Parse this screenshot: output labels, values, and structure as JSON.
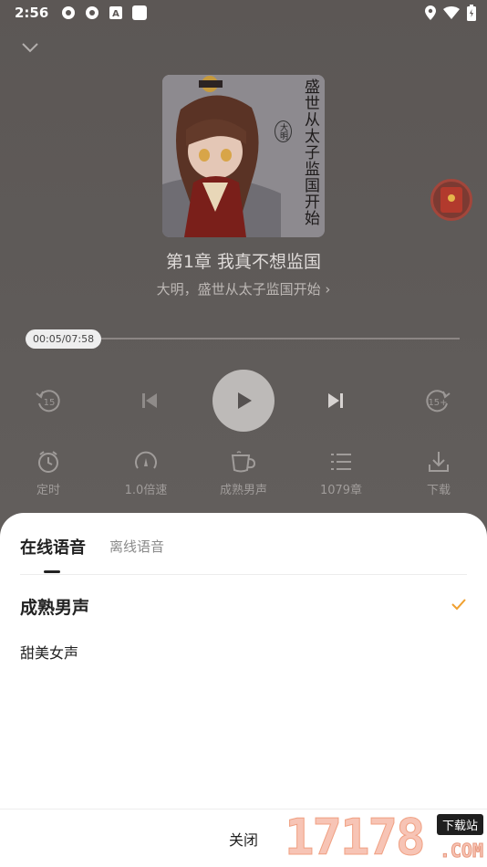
{
  "status_bar": {
    "time": "2:56"
  },
  "player": {
    "cover": {
      "title": "盛世从太子监国开始",
      "badge": "大明"
    },
    "chapter_title": "第1章 我真不想监国",
    "book_link": "大明，盛世从太子监国开始 ›",
    "progress": {
      "time_label": "00:05/07:58",
      "fraction": 0.0105
    },
    "controls": {
      "rewind_label": "15",
      "forward_label": "15+"
    },
    "tools": [
      {
        "label": "定时",
        "icon": "timer-icon"
      },
      {
        "label": "1.0倍速",
        "icon": "speed-icon"
      },
      {
        "label": "成熟男声",
        "icon": "voice-icon"
      },
      {
        "label": "1079章",
        "icon": "chapters-icon"
      },
      {
        "label": "下载",
        "icon": "download-icon"
      }
    ]
  },
  "sheet": {
    "tabs": {
      "online": "在线语音",
      "offline": "离线语音"
    },
    "voices": [
      {
        "label": "成熟男声",
        "selected": true
      },
      {
        "label": "甜美女声",
        "selected": false
      }
    ],
    "close_label": "关闭",
    "accent_color": "#f0a030"
  },
  "watermark": {
    "number": "17178",
    "tag": "下载站",
    "suffix": ".COM"
  }
}
